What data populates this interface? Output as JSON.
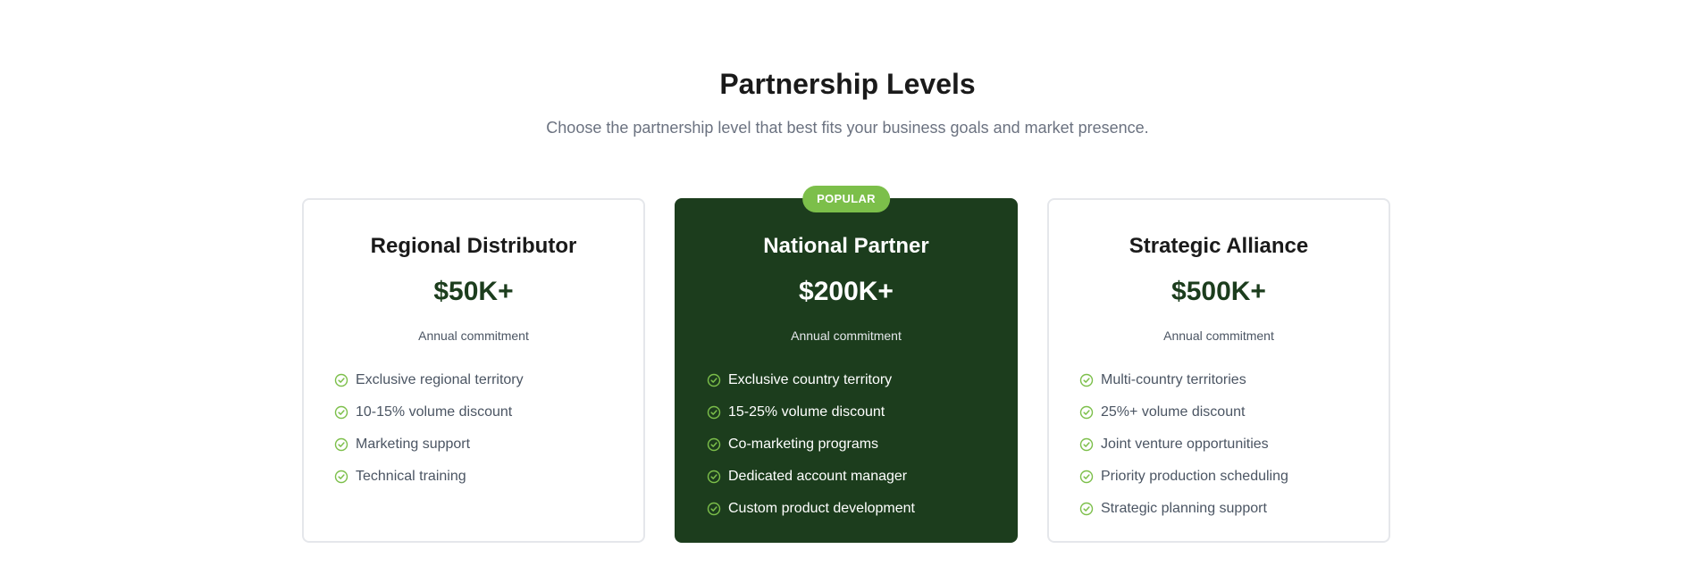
{
  "section": {
    "title": "Partnership Levels",
    "subtitle": "Choose the partnership level that best fits your business goals and market presence."
  },
  "colors": {
    "brand_dark_green": "#1c3d1d",
    "accent_green": "#7cbf4a",
    "text_dark": "#1a1a1a",
    "text_muted": "#6b7280"
  },
  "tiers": [
    {
      "name": "Regional Distributor",
      "price": "$50K+",
      "period": "Annual commitment",
      "featured": false,
      "features": [
        "Exclusive regional territory",
        "10-15% volume discount",
        "Marketing support",
        "Technical training"
      ]
    },
    {
      "name": "National Partner",
      "price": "$200K+",
      "period": "Annual commitment",
      "featured": true,
      "badge": "POPULAR",
      "features": [
        "Exclusive country territory",
        "15-25% volume discount",
        "Co-marketing programs",
        "Dedicated account manager",
        "Custom product development"
      ]
    },
    {
      "name": "Strategic Alliance",
      "price": "$500K+",
      "period": "Annual commitment",
      "featured": false,
      "features": [
        "Multi-country territories",
        "25%+ volume discount",
        "Joint venture opportunities",
        "Priority production scheduling",
        "Strategic planning support"
      ]
    }
  ],
  "icons": {
    "feature_check": "check-circle-icon"
  }
}
